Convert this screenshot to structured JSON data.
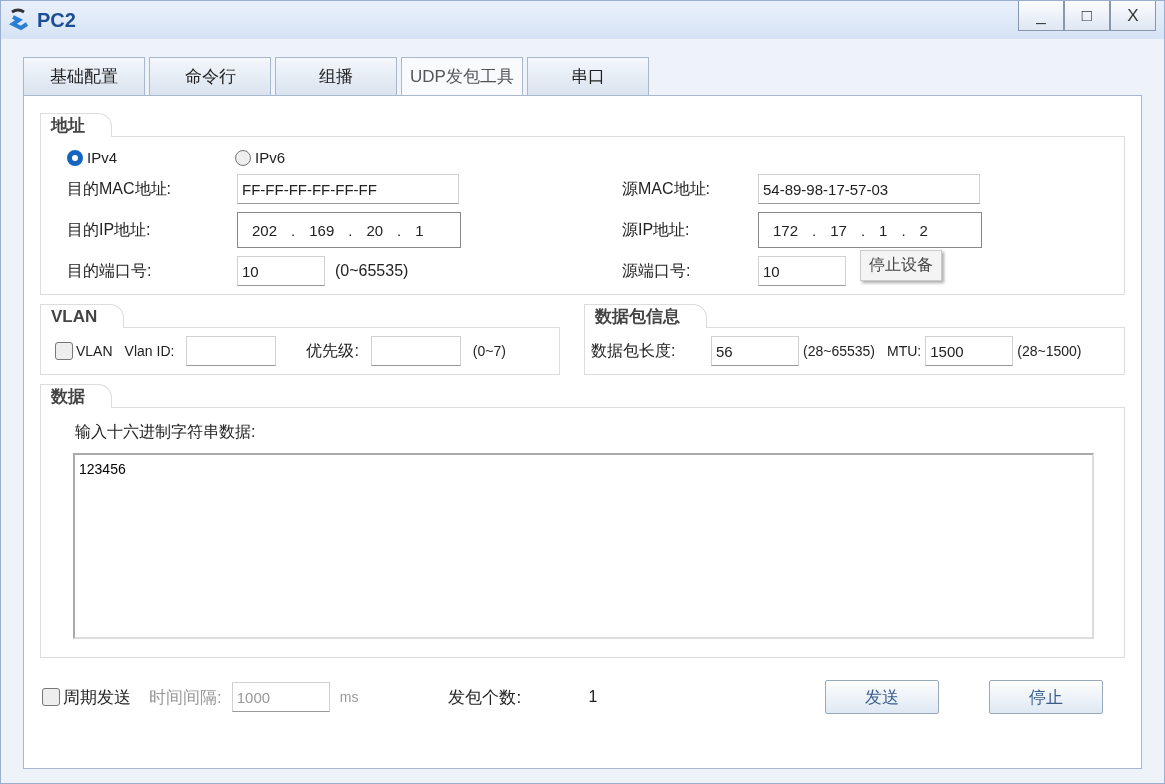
{
  "window": {
    "title": "PC2",
    "controls": [
      "_",
      "□",
      "X"
    ]
  },
  "tabs": [
    {
      "label": "基础配置",
      "selected": false
    },
    {
      "label": "命令行",
      "selected": false
    },
    {
      "label": "组播",
      "selected": false
    },
    {
      "label": "UDP发包工具",
      "selected": true
    },
    {
      "label": "串口",
      "selected": false
    }
  ],
  "address": {
    "title": "地址",
    "ip_versions": [
      {
        "label": "IPv4",
        "selected": true
      },
      {
        "label": "IPv6",
        "selected": false
      }
    ],
    "dst_mac": {
      "label": "目的MAC地址:",
      "value": "FF-FF-FF-FF-FF-FF"
    },
    "src_mac": {
      "label": "源MAC地址:",
      "value": "54-89-98-17-57-03"
    },
    "dst_ip": {
      "label": "目的IP地址:",
      "octets": [
        "202",
        "169",
        "20",
        "1"
      ],
      "separator": "."
    },
    "src_ip": {
      "label": "源IP地址:",
      "octets": [
        "172",
        "17",
        "1",
        "2"
      ],
      "separator": "."
    },
    "dst_port": {
      "label": "目的端口号:",
      "value": "10",
      "range": "(0~65535)"
    },
    "src_port": {
      "label": "源端口号:",
      "value": "10"
    },
    "tooltip": "停止设备"
  },
  "vlan": {
    "title": "VLAN",
    "checkbox": {
      "label": "VLAN",
      "checked": false
    },
    "vlan_id_label": "Vlan ID:",
    "priority_label": "优先级:",
    "priority_range": "(0~7)"
  },
  "packet_info": {
    "title": "数据包信息",
    "length_label": "数据包长度:",
    "length": "56",
    "length_range": "(28~65535)",
    "mtu_label": "MTU:",
    "mtu": "1500",
    "mtu_range": "(28~1500)"
  },
  "data": {
    "title": "数据",
    "prompt": "输入十六进制字符串数据:",
    "value": "123456"
  },
  "bottom": {
    "periodic": {
      "label": "周期发送",
      "checked": false
    },
    "interval_label": "时间间隔:",
    "interval": "1000",
    "interval_unit": "ms",
    "interval_disabled": true,
    "count_label": "发包个数:",
    "count": "1",
    "buttons": [
      "发送",
      "停止"
    ]
  }
}
